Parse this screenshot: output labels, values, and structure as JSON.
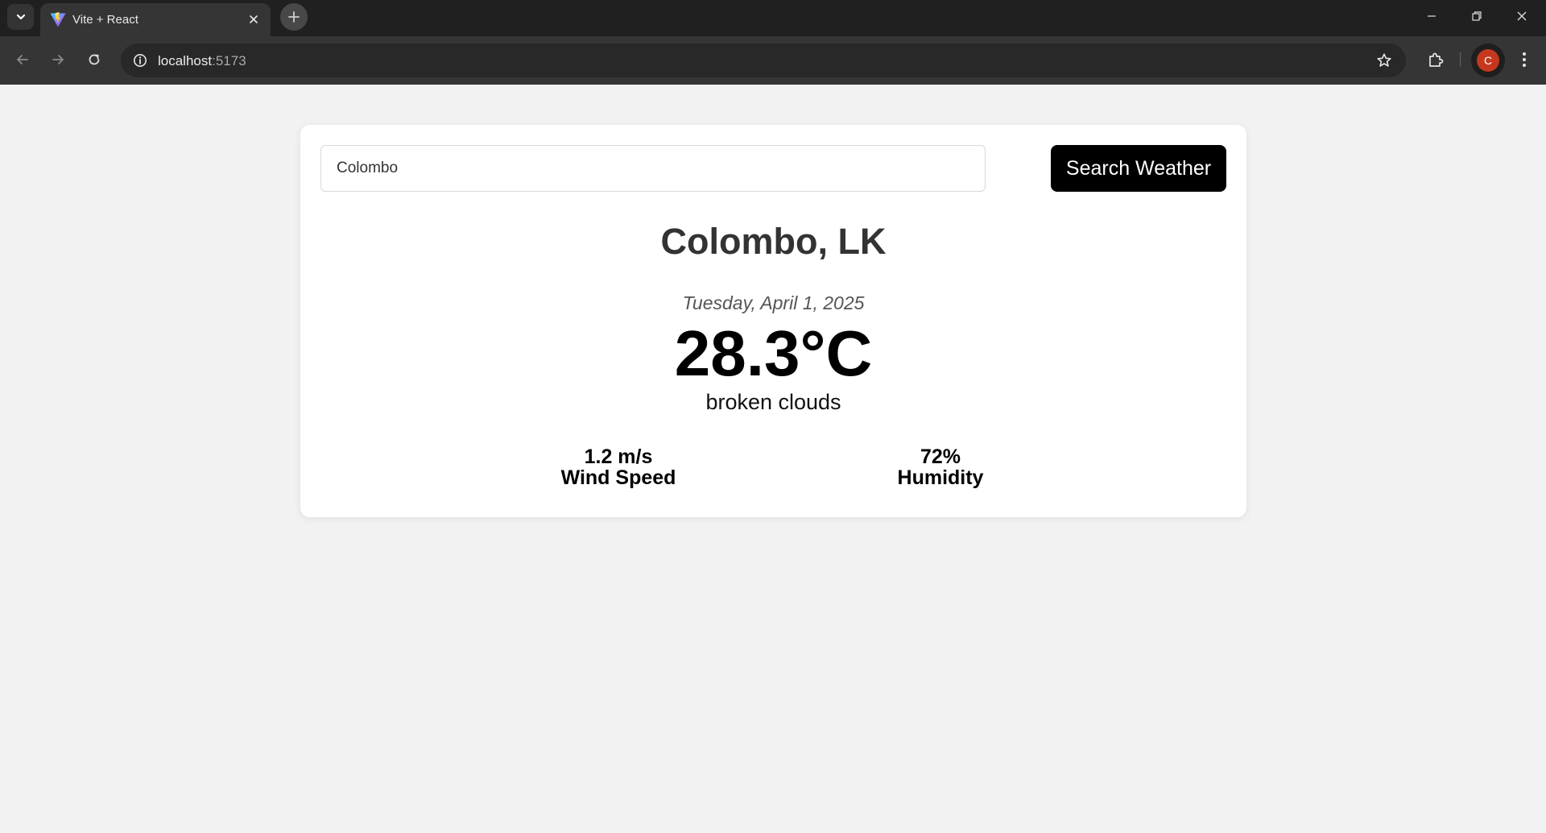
{
  "browser": {
    "tab": {
      "title": "Vite + React"
    },
    "address": {
      "host": "localhost",
      "port": ":5173"
    },
    "profile_initial": "C"
  },
  "icons": {
    "tab_search": "chevron-down-icon",
    "favicon": "vite-logo-icon",
    "tab_close": "close-icon",
    "new_tab": "plus-icon",
    "back": "arrow-left-icon",
    "forward": "arrow-right-icon",
    "reload": "reload-icon",
    "site_info": "info-icon",
    "bookmark": "star-icon",
    "extensions": "puzzle-icon",
    "menu": "kebab-menu-icon"
  },
  "colors": {
    "page_background": "#f2f2f2",
    "card_background": "#ffffff",
    "button_background": "#000000",
    "button_text": "#ffffff",
    "profile_avatar": "#c5381d"
  },
  "search": {
    "value": "Colombo",
    "button_label": "Search Weather"
  },
  "weather": {
    "location": "Colombo, LK",
    "date": "Tuesday, April 1, 2025",
    "temperature": "28.3°C",
    "description": "broken clouds",
    "wind": {
      "value": "1.2 m/s",
      "label": "Wind Speed"
    },
    "humidity": {
      "value": "72%",
      "label": "Humidity"
    }
  }
}
